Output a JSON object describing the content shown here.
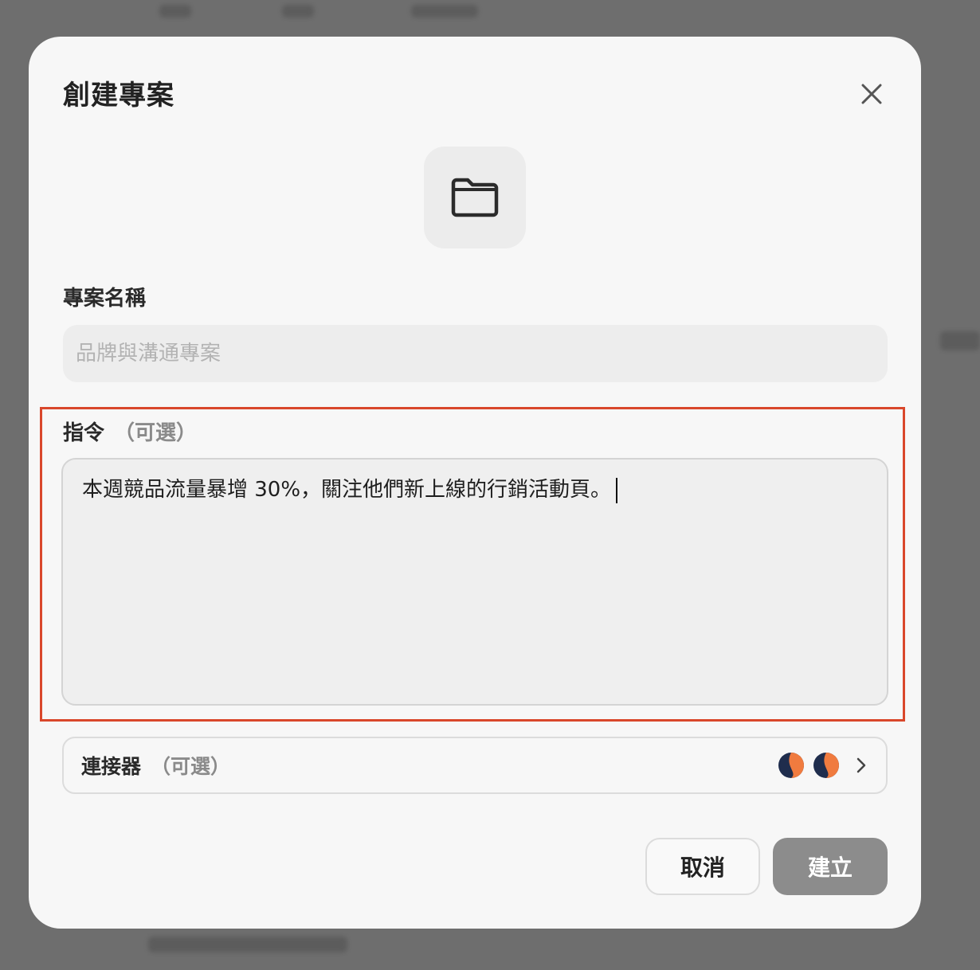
{
  "dialog": {
    "title": "創建專案",
    "close_icon": "close-icon",
    "folder_icon": "folder-icon"
  },
  "project_name": {
    "label": "專案名稱",
    "placeholder": "品牌與溝通專案",
    "value": ""
  },
  "instructions": {
    "label": "指令",
    "optional": "（可選）",
    "value": "本週競品流量暴增 30%，關注他們新上線的行銷活動頁。"
  },
  "connectors": {
    "label": "連接器",
    "optional": "（可選）",
    "icons": [
      "connector-logo-icon",
      "connector-logo-icon"
    ],
    "chevron_icon": "chevron-right-icon"
  },
  "buttons": {
    "cancel": "取消",
    "create": "建立"
  },
  "colors": {
    "highlight_border": "#d9472b",
    "create_button": "#8c8c8c",
    "logo_dark": "#1f2d4d",
    "logo_orange": "#f07b3f"
  }
}
